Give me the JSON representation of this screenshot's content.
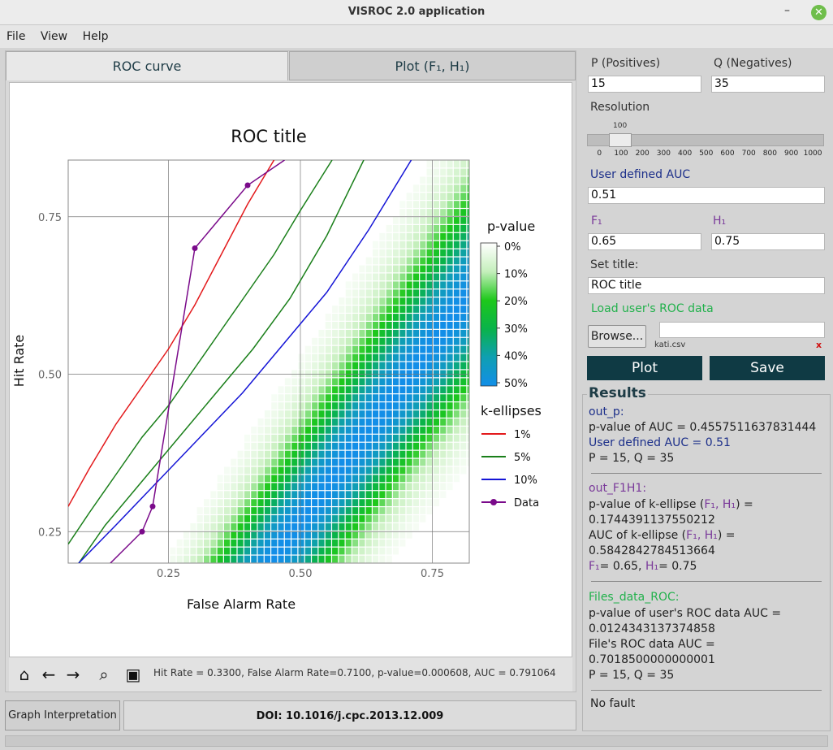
{
  "window": {
    "title": "VISROC 2.0 application",
    "minimize": "–",
    "close": "✕"
  },
  "menu": [
    "File",
    "View",
    "Help"
  ],
  "tabs": [
    "ROC curve",
    "Plot (F₁, H₁)"
  ],
  "chart_data": {
    "type": "line",
    "title": "ROC title",
    "xlabel": "False Alarm Rate",
    "ylabel": "Hit Rate",
    "xlim": [
      0.06,
      0.82
    ],
    "ylim": [
      0.2,
      0.84
    ],
    "xticks": [
      0.25,
      0.5,
      0.75
    ],
    "xticklabels": [
      "0.25",
      "0.50",
      "0.75"
    ],
    "yticks": [
      0.25,
      0.5,
      0.75
    ],
    "yticklabels": [
      "0.25",
      "0.50",
      "0.75"
    ],
    "heatmap": {
      "label": "p-value",
      "ticks": [
        "0%",
        "10%",
        "20%",
        "30%",
        "40%",
        "50%"
      ],
      "colors": [
        "#ffffff",
        "#c5efbc",
        "#1ec81b",
        "#09b34a",
        "#0f9fb2",
        "#128ee8"
      ]
    },
    "legend_title": "k-ellipses",
    "series": [
      {
        "name": "1%",
        "color": "#e31a1c",
        "x": [
          0.06,
          0.1,
          0.15,
          0.2,
          0.25,
          0.3,
          0.35,
          0.4,
          0.45
        ],
        "y": [
          0.29,
          0.35,
          0.42,
          0.48,
          0.54,
          0.61,
          0.69,
          0.77,
          0.84
        ]
      },
      {
        "name": "5%",
        "color": "#1a7f1a",
        "x": [
          0.06,
          0.1,
          0.15,
          0.2,
          0.25,
          0.3,
          0.35,
          0.4,
          0.45,
          0.5,
          0.56
        ],
        "y": [
          0.23,
          0.28,
          0.34,
          0.4,
          0.45,
          0.51,
          0.57,
          0.63,
          0.69,
          0.76,
          0.84
        ]
      },
      {
        "name": "5%",
        "color": "#1a7f1a",
        "x": [
          0.08,
          0.13,
          0.2,
          0.27,
          0.34,
          0.41,
          0.48,
          0.55,
          0.62
        ],
        "y": [
          0.2,
          0.26,
          0.33,
          0.4,
          0.47,
          0.54,
          0.62,
          0.72,
          0.84
        ]
      },
      {
        "name": "10%",
        "color": "#1515d6",
        "x": [
          0.08,
          0.15,
          0.23,
          0.31,
          0.39,
          0.47,
          0.55,
          0.63,
          0.71
        ],
        "y": [
          0.2,
          0.26,
          0.33,
          0.4,
          0.47,
          0.55,
          0.63,
          0.73,
          0.84
        ]
      },
      {
        "name": "Data",
        "color": "#7a0a8a",
        "x": [
          0.14,
          0.2,
          0.22,
          0.3,
          0.4,
          0.47
        ],
        "y": [
          0.2,
          0.25,
          0.29,
          0.7,
          0.8,
          0.84
        ],
        "markers": [
          0.2,
          0.22,
          0.3,
          0.4
        ],
        "marker_y": [
          0.25,
          0.29,
          0.7,
          0.8
        ]
      }
    ]
  },
  "toolbar": {
    "home_icon": "⌂",
    "back_icon": "←",
    "forward_icon": "→",
    "zoom_icon": "⌕",
    "save_icon": "▣",
    "status": "Hit Rate = 0.3300, False Alarm Rate=0.7100, p-value=0.000608, AUC = 0.791064"
  },
  "bottom": {
    "graph_interpretation": "Graph Interpretation",
    "doi": "DOI: 10.1016/j.cpc.2013.12.009"
  },
  "settings": {
    "p_label": "P (Positives)",
    "q_label": "Q (Negatives)",
    "p_value": "15",
    "q_value": "35",
    "resolution_label": "Resolution",
    "resolution_value": "100",
    "resolution_ticks": [
      "0",
      "100",
      "200",
      "300",
      "400",
      "500",
      "600",
      "700",
      "800",
      "900",
      "1000"
    ],
    "auc_label": "User defined AUC",
    "auc_value": "0.51",
    "f1_label": "F₁",
    "h1_label": "H₁",
    "f1_value": "0.65",
    "h1_value": "0.75",
    "title_label": "Set title:",
    "title_value": "ROC title",
    "load_label": "Load user's ROC data",
    "browse": "Browse...",
    "filename": "kati.csv",
    "clear": "x",
    "plot_button": "Plot",
    "save_button": "Save"
  },
  "results": {
    "heading": "Results",
    "out_p": "out_p:",
    "pvalue_auc": "p-value of AUC = 0.4557511637831444",
    "user_auc": "User defined AUC = 0.51",
    "pq1": "P = 15, Q = 35",
    "out_f1h1": "out_F1H1:",
    "pvalue_kellipse_a": "p-value of k-ellipse (",
    "f1h1_paren": "F₁, H₁",
    "pvalue_kellipse_b": ") =",
    "pvalue_kellipse_val": "0.1744391137550212",
    "auc_kellipse_a": "AUC of k-ellipse (",
    "auc_kellipse_val": "0.5842842784513664",
    "f1_res_label": "F₁",
    "f1_res_val": "= 0.65, ",
    "h1_res_label": "H₁",
    "h1_res_val": "= 0.75",
    "files_data": "Files_data_ROC:",
    "pvalue_user": "p-value of user's ROC data AUC =",
    "pvalue_user_val": "0.0124343137374858",
    "file_auc": "File's ROC data AUC =",
    "file_auc_val": "0.7018500000000001",
    "pq2": "P = 15, Q = 35",
    "fault": "No fault"
  }
}
